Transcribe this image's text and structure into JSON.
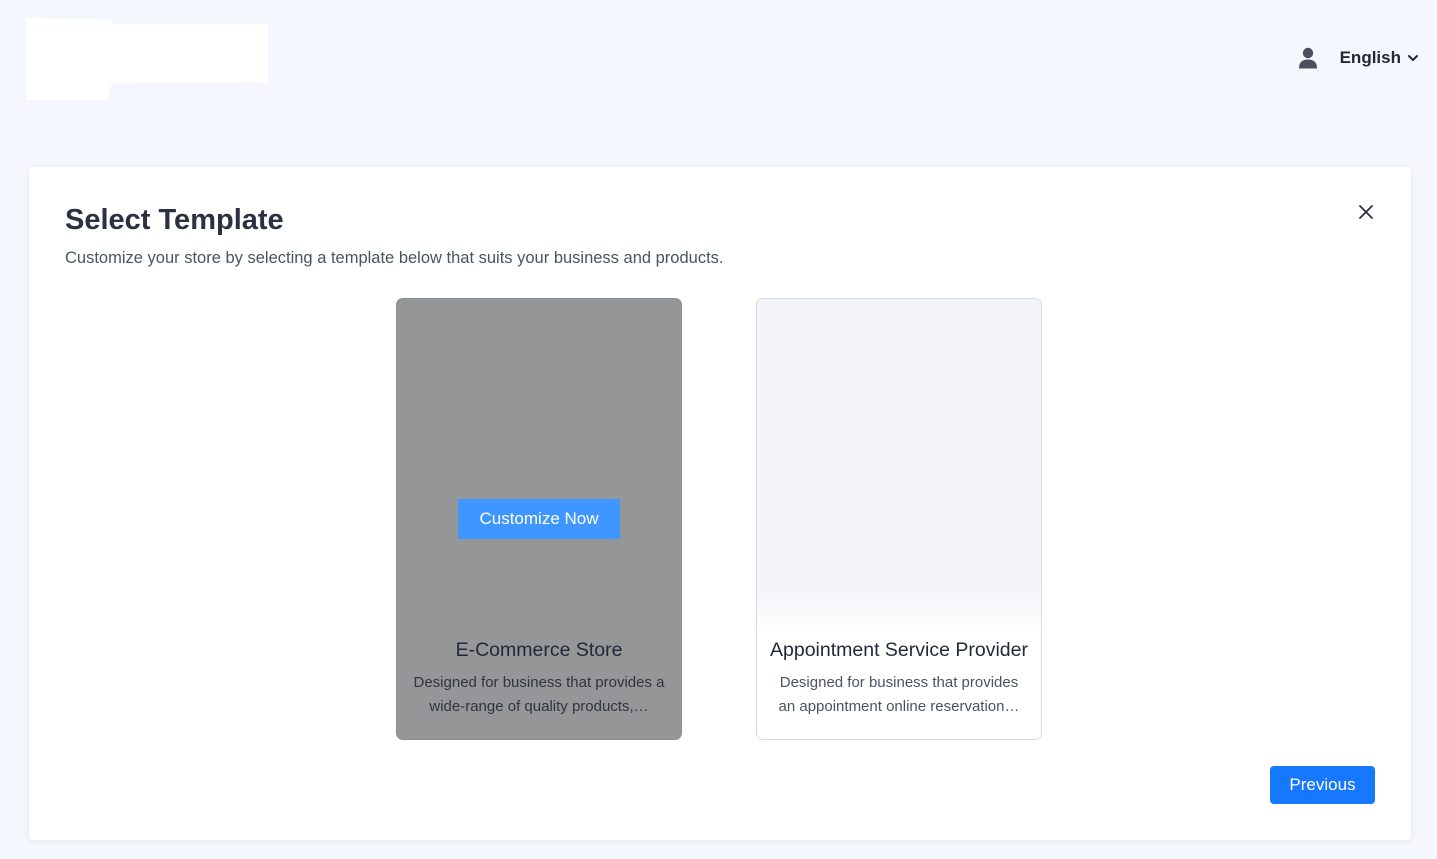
{
  "header": {
    "language": "English",
    "icons": {
      "user": "user-icon",
      "language_dropdown": "chevron-down-icon"
    }
  },
  "modal": {
    "title": "Select Template",
    "subtitle": "Customize your store by selecting a template below that suits your business and products.",
    "close_icon": "close-icon",
    "templates": [
      {
        "title": "E-Commerce Store",
        "description": "Designed for business that provides a wide-range of quality products,…",
        "action_label": "Customize Now",
        "hovered": true
      },
      {
        "title": "Appointment Service Provider",
        "description": "Designed for business that provides an appointment online reservation…"
      }
    ],
    "previous_label": "Previous"
  },
  "colors": {
    "page_background": "#f4f7fd",
    "primary": "#1677ff",
    "customize_button": "#4096ff",
    "hover_overlay": "#959697"
  }
}
